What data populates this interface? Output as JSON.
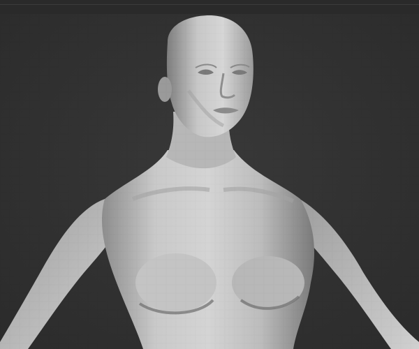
{
  "viewport": {
    "background_color": "#2e2e2e",
    "model_color": "#bdbdbd",
    "subject": "sculpt-mesh-female-bust"
  }
}
